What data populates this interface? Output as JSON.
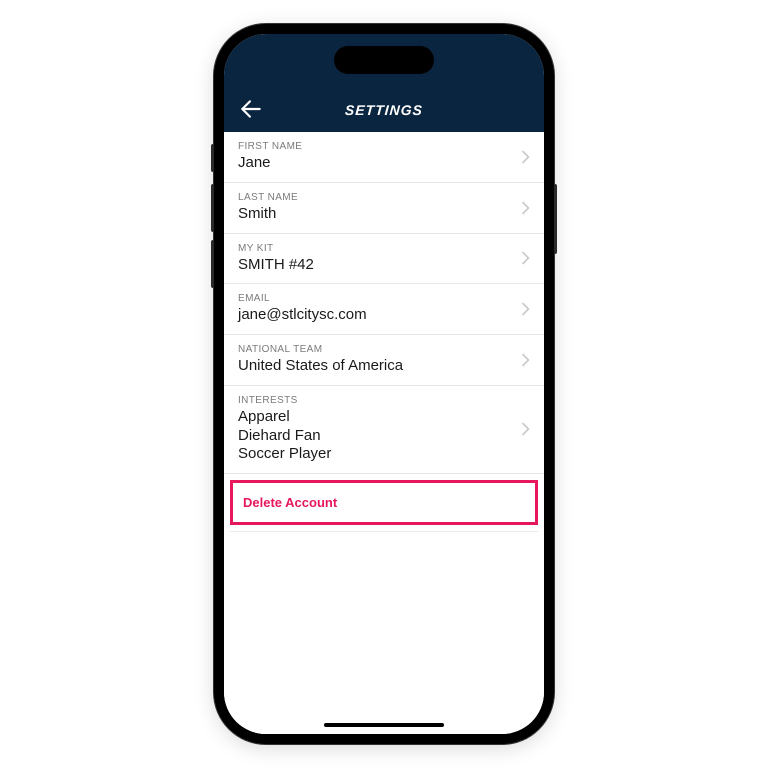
{
  "header": {
    "title": "SETTINGS"
  },
  "rows": {
    "first_name": {
      "label": "FIRST NAME",
      "value": "Jane"
    },
    "last_name": {
      "label": "LAST NAME",
      "value": "Smith"
    },
    "my_kit": {
      "label": "MY KIT",
      "value": "SMITH #42"
    },
    "email": {
      "label": "EMAIL",
      "value": "jane@stlcitysc.com"
    },
    "national_team": {
      "label": "NATIONAL TEAM",
      "value": "United States of America"
    },
    "interests": {
      "label": "INTERESTS",
      "values": [
        "Apparel",
        "Diehard Fan",
        "Soccer Player"
      ]
    }
  },
  "delete": {
    "label": "Delete Account"
  },
  "colors": {
    "header_bg": "#0a2540",
    "highlight": "#e6175e"
  }
}
